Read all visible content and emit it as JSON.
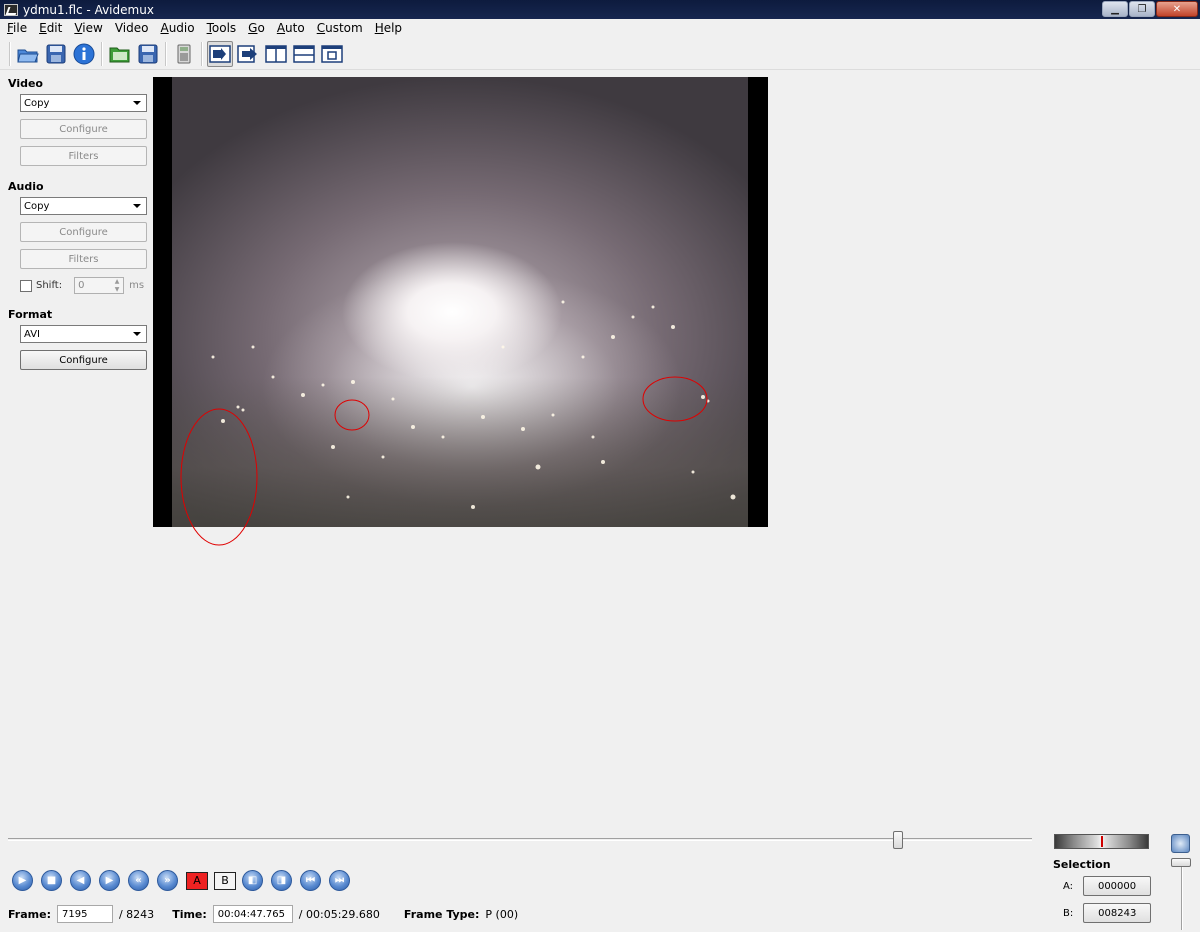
{
  "window": {
    "title": "ydmu1.flc - Avidemux"
  },
  "menu": [
    {
      "label": "File",
      "mnemonic": "F",
      "rest": "ile"
    },
    {
      "label": "Edit",
      "mnemonic": "E",
      "rest": "dit"
    },
    {
      "label": "View",
      "mnemonic": "V",
      "rest": "iew"
    },
    {
      "label": "Video",
      "mnemonic": "V",
      "rest": "ideo"
    },
    {
      "label": "Audio",
      "mnemonic": "A",
      "rest": "udio"
    },
    {
      "label": "Tools",
      "mnemonic": "T",
      "rest": "ools"
    },
    {
      "label": "Go",
      "mnemonic": "G",
      "rest": "o"
    },
    {
      "label": "Auto",
      "mnemonic": "A",
      "rest": "uto"
    },
    {
      "label": "Custom",
      "mnemonic": "C",
      "rest": "ustom"
    },
    {
      "label": "Help",
      "mnemonic": "H",
      "rest": "elp"
    }
  ],
  "toolbar": {
    "icons": [
      "open-icon",
      "save-icon",
      "info-icon",
      "open-folder-icon",
      "save-disk-icon",
      "calculator-icon",
      "display-input-icon",
      "display-output-icon",
      "split-vertical-icon",
      "split-horizontal-icon",
      "preview-window-icon"
    ]
  },
  "video": {
    "label": "Video",
    "codec": "Copy",
    "configure": "Configure",
    "filters": "Filters"
  },
  "audio": {
    "label": "Audio",
    "codec": "Copy",
    "configure": "Configure",
    "filters": "Filters",
    "shift_label": "Shift:",
    "shift_value": "0",
    "shift_unit": "ms"
  },
  "format": {
    "label": "Format",
    "container": "AVI",
    "configure": "Configure"
  },
  "navigation": {
    "icons": [
      "play-icon",
      "stop-icon",
      "previous-frame-icon",
      "next-frame-icon",
      "previous-keyframe-icon",
      "next-keyframe-icon"
    ],
    "marker_a": "A",
    "marker_b": "B",
    "tail_icons": [
      "go-to-a-icon",
      "go-to-b-icon",
      "previous-black-frame-icon",
      "next-black-frame-icon"
    ]
  },
  "status": {
    "frame_label": "Frame:",
    "frame_value": "7195",
    "frame_total": "/ 8243",
    "time_label": "Time:",
    "time_value": "00:04:47.765",
    "time_total": "/ 00:05:29.680",
    "frame_type_label": "Frame Type:",
    "frame_type_value": "P (00)"
  },
  "selection": {
    "label": "Selection",
    "a_label": "A:",
    "a_value": "000000",
    "b_label": "B:",
    "b_value": "008243"
  },
  "timeline": {
    "position_fraction": 0.873
  },
  "colors": {
    "titlebar": "#0d1b3e",
    "annotation": "#e00000",
    "accent": "#2e5a9c"
  }
}
